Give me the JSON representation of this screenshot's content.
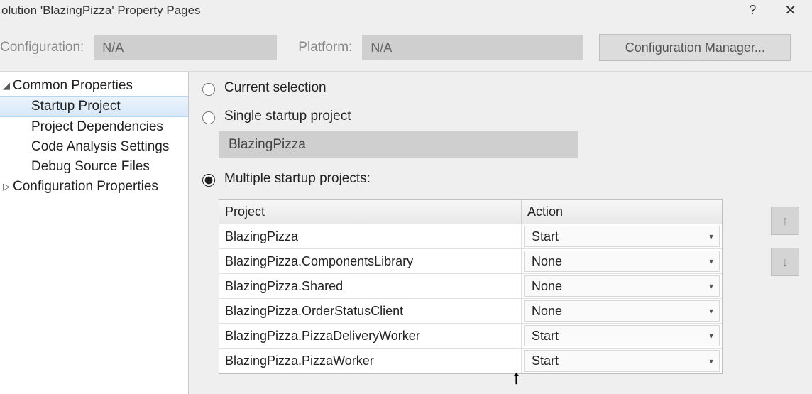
{
  "window": {
    "title": "olution 'BlazingPizza' Property Pages",
    "help": "?",
    "close": "✕"
  },
  "config_row": {
    "config_label": "Configuration:",
    "config_value": "N/A",
    "platform_label": "Platform:",
    "platform_value": "N/A",
    "manager_button": "Configuration Manager..."
  },
  "tree": {
    "common": {
      "label": "Common Properties",
      "children": {
        "startup": "Startup Project",
        "deps": "Project Dependencies",
        "analysis": "Code Analysis Settings",
        "debug_src": "Debug Source Files"
      }
    },
    "config_props": {
      "label": "Configuration Properties"
    }
  },
  "startup": {
    "current_label": "Current selection",
    "single_label": "Single startup project",
    "single_value": "BlazingPizza",
    "multi_label": "Multiple startup projects:",
    "table": {
      "headers": {
        "project": "Project",
        "action": "Action"
      },
      "rows": [
        {
          "project": "BlazingPizza",
          "action": "Start"
        },
        {
          "project": "BlazingPizza.ComponentsLibrary",
          "action": "None"
        },
        {
          "project": "BlazingPizza.Shared",
          "action": "None"
        },
        {
          "project": "BlazingPizza.OrderStatusClient",
          "action": "None"
        },
        {
          "project": "BlazingPizza.PizzaDeliveryWorker",
          "action": "Start"
        },
        {
          "project": "BlazingPizza.PizzaWorker",
          "action": "Start"
        }
      ]
    },
    "selected_mode": "multiple"
  },
  "reorder": {
    "up": "↑",
    "down": "↓"
  }
}
